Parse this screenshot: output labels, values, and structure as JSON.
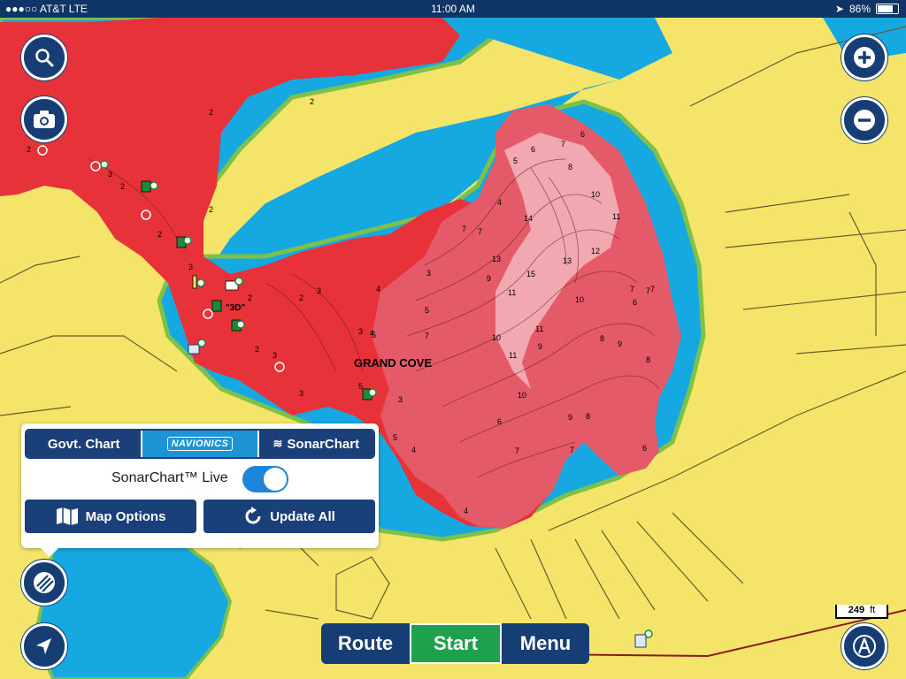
{
  "status_bar": {
    "carrier": "●●●○○ AT&T  LTE",
    "time": "11:00 AM",
    "battery_text": "86%",
    "battery_level": 0.86
  },
  "map": {
    "place_label": "GRAND COVE",
    "marker_label": "\"3D\"",
    "depth_soundings": [
      "2",
      "2",
      "2",
      "3",
      "2",
      "2",
      "2",
      "3",
      "2",
      "3",
      "2",
      "3",
      "4",
      "3",
      "4",
      "2",
      "3",
      "3",
      "5",
      "7",
      "7",
      "7",
      "4",
      "5",
      "6",
      "7",
      "6",
      "8",
      "10",
      "11",
      "14",
      "15",
      "11",
      "9",
      "13",
      "13",
      "12",
      "10",
      "11",
      "10",
      "9",
      "11",
      "8",
      "9",
      "8",
      "10",
      "9",
      "8",
      "7",
      "7",
      "6",
      "7",
      "7",
      "4",
      "6",
      "5",
      "5",
      "5",
      "3",
      "4",
      "6",
      "7"
    ],
    "colors": {
      "land": "#f5e46a",
      "water": "#16a8e0",
      "shore": "#7dc14a",
      "sonar_shallow": "#e8323a",
      "sonar_mid": "#e45a68",
      "sonar_deep": "#f2a8b0"
    }
  },
  "controls": {
    "search_icon": "search-icon",
    "camera_icon": "camera-icon",
    "zoom_in_icon": "plus-icon",
    "zoom_out_icon": "minus-icon",
    "layers_icon": "chart-layers-icon",
    "locate_icon": "location-arrow-icon",
    "compass_icon": "compass-icon"
  },
  "chart_panel": {
    "tabs": [
      {
        "label": "Govt. Chart",
        "active": false
      },
      {
        "label": "NAVIONICS",
        "active": true
      },
      {
        "label": "SonarChart",
        "active": false
      }
    ],
    "live_label": "SonarChart™ Live",
    "live_on": true,
    "map_options_label": "Map Options",
    "update_all_label": "Update All"
  },
  "bottom_bar": {
    "route_label": "Route",
    "start_label": "Start",
    "menu_label": "Menu"
  },
  "scale": {
    "value": "249",
    "unit": "ft"
  },
  "accent_colors": {
    "nav_blue": "#163e75",
    "active_blue": "#1d95d4",
    "start_green": "#1fa04d"
  }
}
